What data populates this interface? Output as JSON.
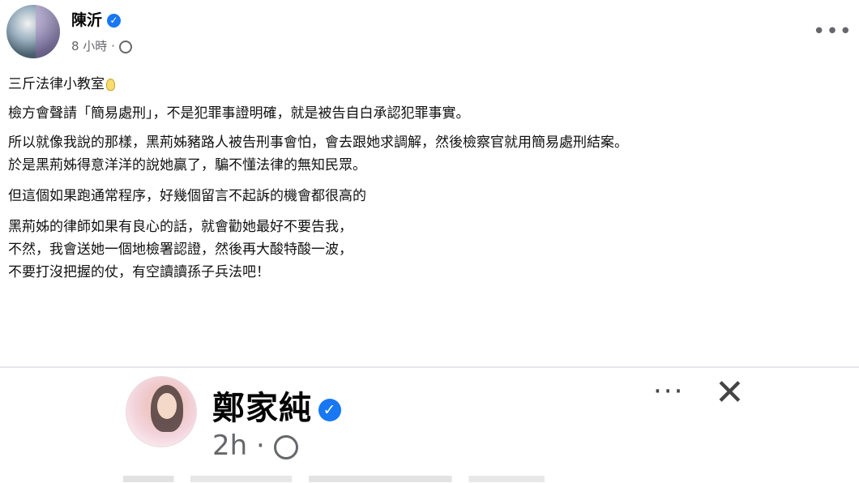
{
  "post1": {
    "author": "陳沂",
    "time": "8 小時",
    "separator": "·",
    "more_icon": "more-horizontal-icon",
    "verified_icon": "verified-badge-icon",
    "privacy_icon": "globe-icon",
    "lines": [
      "三斤法律小教室",
      "檢方會聲請「簡易處刑」，不是犯罪事證明確，就是被告自白承認犯罪事實。",
      "所以就像我說的那樣，黑荊姊豬路人被告刑事會怕，會去跟她求調解，然後檢察官就用簡易處刑結案。",
      "於是黑荊姊得意洋洋的說她贏了，騙不懂法律的無知民眾。",
      "但這個如果跑通常程序，好幾個留言不起訴的機會都很高的",
      "黑荊姊的律師如果有良心的話，就會勸她最好不要告我，",
      "不然，我會送她一個地檢署認證，然後再大酸特酸一波，",
      "不要打沒把握的仗，有空讀讀孫子兵法吧！"
    ]
  },
  "post2": {
    "author": "鄭家純",
    "time": "2h",
    "separator": "·",
    "more_label": "···",
    "close_label": "✕",
    "verified_icon": "verified-badge-icon",
    "privacy_icon": "globe-icon"
  },
  "colors": {
    "verified_blue": "#1877f2",
    "meta_gray": "#65676b",
    "divider": "#e4e6eb"
  }
}
